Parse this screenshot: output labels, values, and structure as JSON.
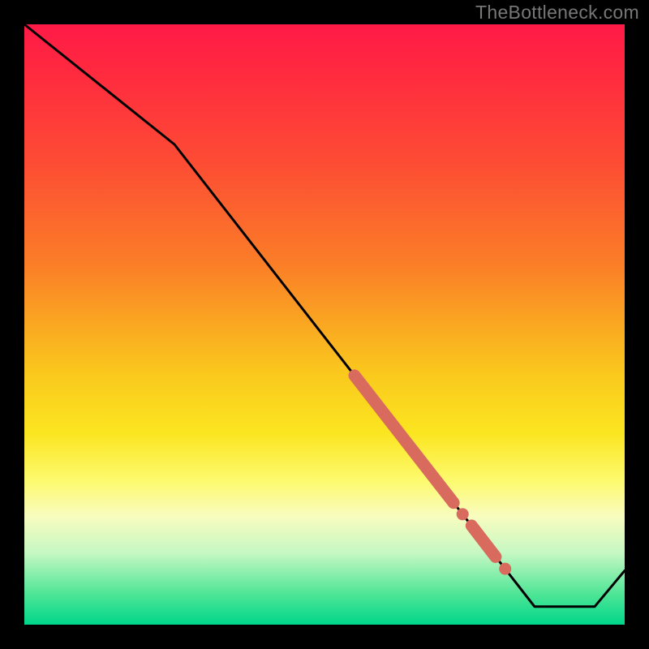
{
  "watermark": "TheBottleneck.com",
  "chart_data": {
    "type": "line",
    "title": "",
    "xlabel": "",
    "ylabel": "",
    "xlim": [
      0,
      100
    ],
    "ylim": [
      0,
      100
    ],
    "grid": false,
    "legend": false,
    "series": [
      {
        "name": "curve",
        "color": "#000000",
        "x": [
          0,
          25,
          85,
          95,
          100
        ],
        "values": [
          100,
          80,
          3,
          3,
          9
        ]
      }
    ],
    "markers": [
      {
        "name": "band-upper",
        "shape": "line-segment",
        "color": "#d86a5e",
        "x": [
          55,
          71.5
        ],
        "values": [
          41.5,
          20.3
        ]
      },
      {
        "name": "dot-mid",
        "shape": "circle",
        "color": "#d86a5e",
        "x": 73,
        "value": 18.4
      },
      {
        "name": "band-lower",
        "shape": "line-segment",
        "color": "#d86a5e",
        "x": [
          74.5,
          78.5
        ],
        "values": [
          16.5,
          11.3
        ]
      },
      {
        "name": "dot-low",
        "shape": "circle",
        "color": "#d86a5e",
        "x": 80.1,
        "value": 9.3
      }
    ]
  }
}
